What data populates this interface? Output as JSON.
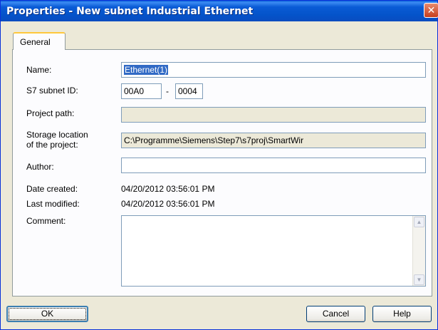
{
  "window": {
    "title": "Properties - New subnet Industrial Ethernet",
    "close_glyph": "✕"
  },
  "tabs": [
    {
      "label": "General"
    }
  ],
  "form": {
    "name_label": "Name:",
    "name_value": "Ethernet(1)",
    "subnet_label": "S7 subnet ID:",
    "subnet_part1": "00A0",
    "subnet_sep": "-",
    "subnet_part2": "0004",
    "project_path_label": "Project path:",
    "project_path_value": "",
    "storage_label_1": "Storage location",
    "storage_label_2": "of the project:",
    "storage_value": "C:\\Programme\\Siemens\\Step7\\s7proj\\SmartWir",
    "author_label": "Author:",
    "author_value": "",
    "date_created_label": "Date created:",
    "date_created_value": "04/20/2012 03:56:01 PM",
    "last_modified_label": "Last modified:",
    "last_modified_value": "04/20/2012 03:56:01 PM",
    "comment_label": "Comment:",
    "comment_value": ""
  },
  "buttons": {
    "ok": "OK",
    "cancel": "Cancel",
    "help": "Help"
  },
  "icons": {
    "scroll_up": "up-arrow-icon",
    "scroll_down": "down-arrow-icon"
  }
}
